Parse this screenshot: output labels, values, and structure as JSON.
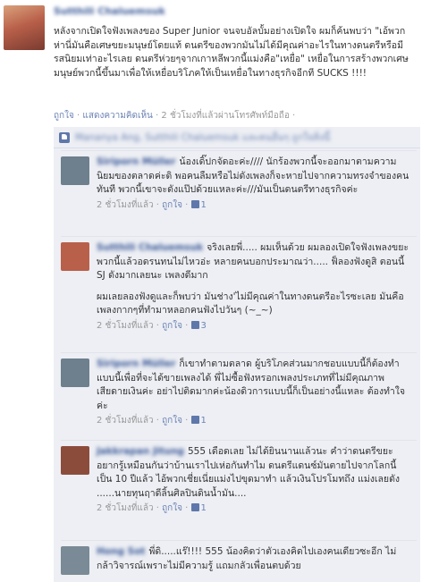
{
  "post": {
    "author": "Sutthili Chaluemsuk",
    "text": "หลังจากเปิดใจฟังเพลงของ Super Junior จนจบอัลบั้มอย่างเปิดใจ ผมก็ค้นพบว่า \"เอ้พวกห่านี่มันคือเศษขยะมนุษย์โดยแท้ ดนตรีของพวกมันไม่ได้มีคุณค่าอะไรในทางดนตรีหรือมีรสนิยมเท่าอะไรเลย ดนตรีห่วยๆจากเกาหลีพวกนี้แม่งคือ\"เหยื่อ\" เหยื่อในการสร้างพวกเศษมนุษย์พวกนี้ขึ้นมาเพื่อให้เหยื่อบริโภคให้เป็นเหยื่อในทางธุรกิจอีกที SUCKS !!!!",
    "actions": {
      "like": "ถูกใจ",
      "sep1": " · ",
      "comment": "แสดงความคิดเห็น",
      "sep2": " · ",
      "time": "2 ชั่วโมงที่แล้วผ่านโทรศัพท์มือถือ",
      "sep3": " · "
    }
  },
  "like_bar": {
    "text": "Mananya Ang, Sutthili Chaluemsuk และคนอื่นๆ ถูกใจสิ่งนี้"
  },
  "comments": [
    {
      "author": "Siriporn Müller",
      "text": "น้องเดิ๊ปกจัดอะค่ะ//// นักร้องพวกนี้จะออกมาตามความนิยมของตลาดค่ะดิ พอคนลืมหรือไม่ดังเพลงก็จะหายไปจากความทรงจำของคนทันที พวกนี้เขาจะดังแป๊ปด้วยแหละค่ะ///มันเป็นดนตรีทางธุรกิจค่ะ",
      "time": "2 ชั่วโมงที่แล้ว",
      "sep": " · ",
      "like": "ถูกใจ",
      "sep2": " · ",
      "likes": "1",
      "avatar_color": "#6e7f8e"
    },
    {
      "author": "Sutthili Chaluemsuk",
      "text": "จริงเลยพี่..... ผมเห็นด้วย ผมลองเปิดใจฟังเพลงขยะพวกนี้แล้วอดรนทนไม่ไหวอ่ะ หลายคนบอกประมาณว่า..... ฟ็ลองฟังดูสิ ตอนนี้ SJ ดังมากเลยนะ เพลงดีมาก",
      "text2": "ผมเลยลองฟังดูและก็พบว่า มันช่าง'ไม่มีคุณค่าในทางดนตรีอะไรซะเลย มันคือเพลงกากๆที่ทำมาหลอกคนฟังไปวันๆ (~_~)",
      "time": "2 ชั่วโมงที่แล้ว",
      "sep": " · ",
      "like": "ถูกใจ",
      "sep2": " · ",
      "likes": "3",
      "avatar_color": "#b9604a"
    },
    {
      "author": "Siriporn Müller",
      "text": "ก็เขาทำตามตลาด ผู้บริโภคส่วนมากชอบแบบนี้ก็ต้องทำแบบนี้เพื่อที่จะได้ขายเพลงได้ พี่ไม่ซื้อฟังหรอกเพลงประเภทที่ไม่มีคุณภาพเสียดายเงินค่ะ อย่าไปติดมากค่ะน้องดิวการแบบนี้ก็เป็นอย่างนี้แหละ ต้องทำใจค่ะ",
      "time": "2 ชั่วโมงที่แล้ว",
      "sep": " · ",
      "like": "ถูกใจ",
      "sep2": " · ",
      "likes": "1",
      "avatar_color": "#6e7f8e"
    },
    {
      "author": "Jakkrapan Jitung",
      "text": "555 เดือดเลย ไม่ได้ยินนานแล้วนะ คำว่าดนตรีขยะ อยากรู้เหมือนกันว่าบ้านเราไปเห่อกันทำไม ดนตรีแดนซ์มันตายไปจากโลกนี้เป็น 10 ปีแล้ว ไอ้พวกเชี่ยเนี่ยแม่งไปขุดมาทำ แล้วเงินโปรโมทถึง แม่งเลยดัง ......นายทุนฤาดีลิ้นศิลปินดินน้ำมัน....",
      "time": "2 ชั่วโมงที่แล้ว",
      "sep": " · ",
      "like": "ถูกใจ",
      "sep2": " · ",
      "likes": "1",
      "avatar_color": "#8c4c3c"
    },
    {
      "author": "Hong Sot",
      "text": "พี่ดิ.....แร๊!!!! 555 น้องคิดว่าตัวเองคิดไปเองคนเดียวซะอีก ไม่กล้าวิจารณ์เพราะไม่มีความรู้ แถมกลัวเพื่อนตบด้วย",
      "time": "",
      "avatar_color": "#7a8a96"
    }
  ]
}
